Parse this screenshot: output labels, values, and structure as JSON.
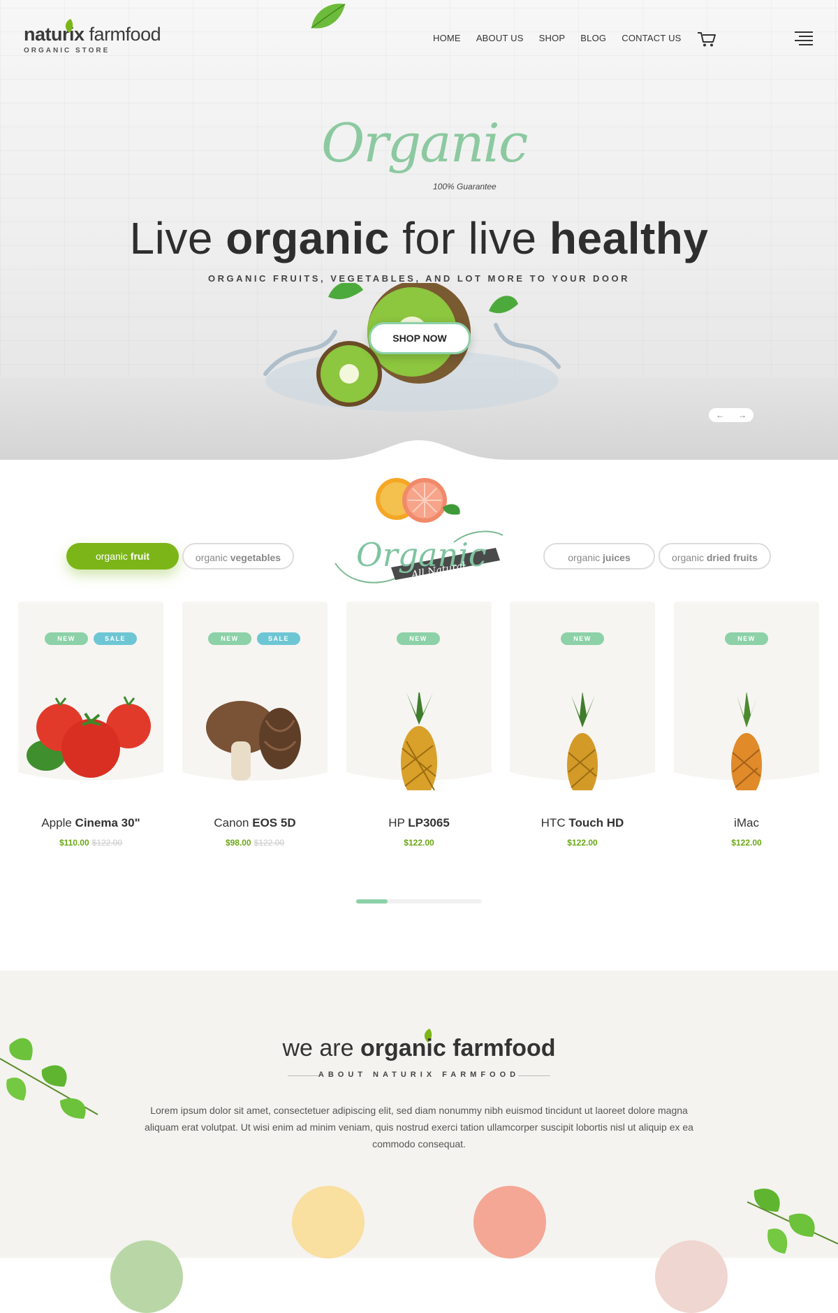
{
  "header": {
    "logo_bold": "naturix",
    "logo_light": "farmfood",
    "logo_tagline": "ORGANIC STORE",
    "nav": [
      "HOME",
      "ABOUT US",
      "SHOP",
      "BLOG",
      "CONTACT US"
    ]
  },
  "hero": {
    "script_word": "Organic",
    "guarantee": "100% Guarantee",
    "headline_1": "Live ",
    "headline_2": "organic",
    "headline_3": " for live ",
    "headline_4": "healthy",
    "subline": "ORGANIC FRUITS, VEGETABLES, AND LOT MORE TO YOUR DOOR",
    "cta": "SHOP NOW",
    "prev_arrow": "←",
    "next_arrow": "→"
  },
  "products": {
    "badge_script": "Organic",
    "badge_ribbon": "All Natural",
    "tabs": [
      {
        "light": "organic ",
        "bold": "fruit"
      },
      {
        "light": "organic ",
        "bold": "vegetables"
      },
      {
        "light": "organic ",
        "bold": "juices"
      },
      {
        "light": "organic ",
        "bold": "dried fruits"
      }
    ],
    "items": [
      {
        "brand": "Apple ",
        "model": "Cinema 30\"",
        "price": "$110.00",
        "old_price": "$122.00",
        "new_label": "NEW",
        "sale_label": "SALE",
        "image": "tomatoes-icon"
      },
      {
        "brand": "Canon ",
        "model": "EOS 5D",
        "price": "$98.00",
        "old_price": "$122.00",
        "new_label": "NEW",
        "sale_label": "SALE",
        "image": "mushrooms-icon"
      },
      {
        "brand": "HP ",
        "model": "LP3065",
        "price": "$122.00",
        "new_label": "NEW",
        "image": "pineapple-icon"
      },
      {
        "brand": "HTC ",
        "model": "Touch HD",
        "price": "$122.00",
        "new_label": "NEW",
        "image": "pineapple-icon"
      },
      {
        "brand": "iMac",
        "model": "",
        "price": "$122.00",
        "new_label": "NEW",
        "image": "pineapple-icon"
      }
    ],
    "pager_progress": 0.25
  },
  "about": {
    "title_light": "we are ",
    "title_bold": "organic farmfood",
    "subtitle": "ABOUT NATURIX FARMFOOD",
    "text": "Lorem ipsum dolor sit amet, consectetuer adipiscing elit, sed diam nonummy nibh euismod tincidunt ut laoreet dolore magna aliquam erat volutpat. Ut wisi enim ad minim veniam, quis nostrud exerci tation ullamcorper suscipit lobortis nisl ut aliquip ex ea commodo consequat."
  },
  "colors": {
    "accent_green": "#7cb518",
    "mint": "#8cd1a8",
    "teal": "#6ec6d4"
  }
}
